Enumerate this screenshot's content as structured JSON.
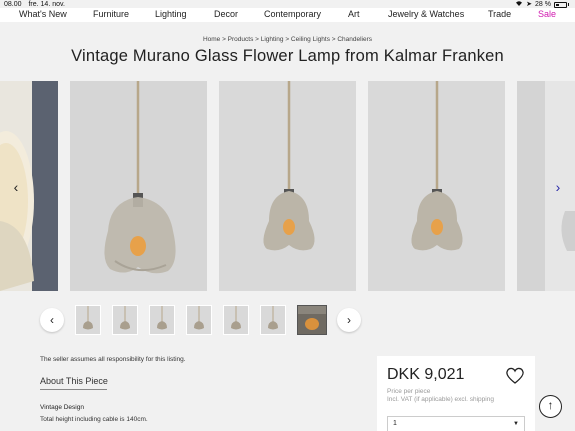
{
  "status_bar": {
    "time": "08.00",
    "date": "fre. 14. nov.",
    "battery": "28 %"
  },
  "nav": {
    "items": [
      "What's New",
      "Furniture",
      "Lighting",
      "Decor",
      "Contemporary",
      "Art",
      "Jewelry & Watches",
      "Trade",
      "Sale"
    ],
    "sale_color": "#d11bb0"
  },
  "breadcrumb": "Home > Products > Lighting > Ceiling Lights > Chandeliers",
  "title": "Vintage Murano Glass Flower Lamp from Kalmar Franken",
  "gallery": {
    "arrow_left": "‹",
    "arrow_right": "›",
    "thumbnails_count": 7,
    "active_thumbnail": 7
  },
  "thumb_nav": {
    "prev": "‹",
    "next": "›"
  },
  "seller_note": "The seller assumes all responsibility for this listing.",
  "about": {
    "heading": "About This Piece",
    "design_title": "Vintage Design",
    "design_desc": "Total height including cable is 140cm."
  },
  "price_card": {
    "price": "DKK 9,021",
    "per_piece": "Price per piece",
    "vat": "Incl. VAT (if applicable) excl. shipping",
    "quantity": "1",
    "quantity_caret": "▼"
  },
  "scroll_top": "↑"
}
